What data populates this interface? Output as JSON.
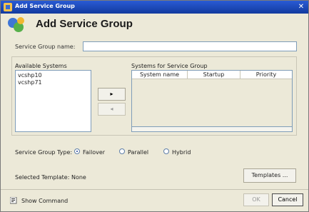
{
  "window": {
    "title": "Add Service Group"
  },
  "header": {
    "title": "Add Service Group"
  },
  "form": {
    "name_label": "Service Group name:",
    "name_value": "",
    "available_label": "Available Systems",
    "available_systems": [
      "vcshp10",
      "vcshp71"
    ],
    "move_right": "▸",
    "move_left": "◂",
    "systems_label": "Systems for Service Group",
    "columns": [
      "System name",
      "Startup",
      "Priority"
    ],
    "type_label": "Service Group Type:",
    "types": [
      "Failover",
      "Parallel",
      "Hybrid"
    ],
    "selected_type": "Failover",
    "template_label": "Selected Template: None",
    "templates_button": "Templates ..."
  },
  "footer": {
    "command_label": "Show Command",
    "ok": "OK",
    "cancel": "Cancel"
  },
  "colors": {
    "titlebar": "#1f4fbf",
    "dialog_bg": "#ece9d8"
  }
}
